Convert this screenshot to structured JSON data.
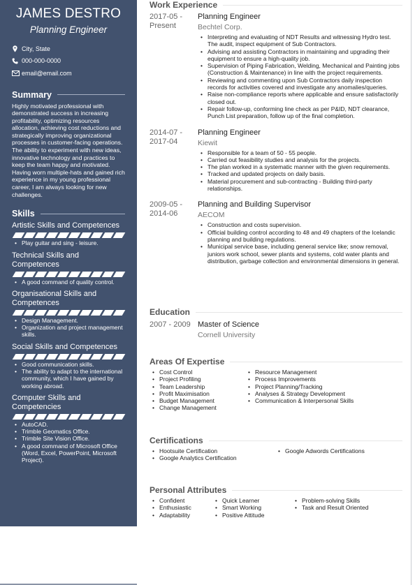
{
  "header": {
    "name": "JAMES DESTRO",
    "role": "Planning Engineer"
  },
  "contacts": [
    {
      "icon": "location-pin-icon",
      "text": "City, State"
    },
    {
      "icon": "phone-icon",
      "text": "000-000-0000"
    },
    {
      "icon": "envelope-icon",
      "text": "email@email.com"
    }
  ],
  "summary": {
    "heading": "Summary",
    "text": "Highly motivated professional with demonstrated success in increasing profitability, optimizing resources allocation, achieving cost reductions and strategically improving organizational processes in customer-facing operations. The ability to experiment with new ideas, innovative technology and practices to keep the team happy and motivated. Having worn multiple-hats and gained rich experience in my young professional career, I am always looking for new challenges."
  },
  "skills": {
    "heading": "Skills",
    "groups": [
      {
        "name": "Artistic Skills and Competences",
        "level": 1.0,
        "items": [
          "Play guitar and sing - leisure."
        ]
      },
      {
        "name": "Technical Skills and Competences",
        "level": 1.0,
        "items": [
          "A good command of quality control."
        ]
      },
      {
        "name": "Organisational Skills and Competences",
        "level": 1.0,
        "items": [
          "Design Management.",
          "Organization and project management skills."
        ]
      },
      {
        "name": "Social Skills and Competences",
        "level": 1.0,
        "items": [
          "Good communication skills.",
          "The ability to adapt to the international community, which I have gained by working abroad."
        ]
      },
      {
        "name": "Computer Skills and Competencies",
        "level": 1.0,
        "items": [
          "AutoCAD.",
          "Trimble Geomatics Office.",
          "Trimble Site Vision Office.",
          "A good command of Microsoft Office (Word, Excel, PowerPoint, Microsoft Project)."
        ]
      }
    ]
  },
  "work": {
    "heading": "Work Experience",
    "jobs": [
      {
        "dates": "2017-05 - Present",
        "title": "Planning Engineer",
        "org": "Bechtel Corp.",
        "items": [
          "Interpreting and evaluating of NDT Results and witnessing Hydro test. The audit, inspect equipment of Sub Contractors.",
          "Advising and assisting Contractors in maintaining and upgrading their equipment to ensure a high-quality job.",
          "Supervision of Piping Fabrication, Welding, Mechanical and Painting jobs (Construction & Maintenance) in line with the project requirements.",
          "Reviewing and commenting upon Sub Contractors daily inspection records for activities covered and investigate any anomalies/queries.",
          "Raise non-compliance reports where applicable and ensure satisfactorily closed out.",
          "Repair follow-up, conforming line check as per P&ID, NDT clearance, Punch List preparation, follow up of the final completion."
        ]
      },
      {
        "dates": "2014-07 - 2017-04",
        "title": "Planning Engineer",
        "org": "Kiewit",
        "items": [
          "Responsible for a team of 50 - 55 people.",
          "Carried out feasibility studies and analysis for the projects.",
          "The plan worked in a systematic manner with the given requirements.",
          "Tracked and updated projects on daily basis.",
          "Material procurement and sub-contracting - Building third-party relationships."
        ]
      },
      {
        "dates": "2009-05 - 2014-06",
        "title": "Planning and Building Supervisor",
        "org": "AECOM",
        "items": [
          "Construction and costs supervision.",
          "Official building control according to 48 and 49 chapters of the Icelandic planning and building regulations.",
          "Municipal service base, including general service like; snow removal, juniors work school, sewer plants and systems, cold water plants and distribution, garbage  collection and environmental dimensions in general."
        ]
      }
    ]
  },
  "education": {
    "heading": "Education",
    "entries": [
      {
        "dates": "2007 - 2009",
        "degree": "Master of Science",
        "school": "Cornell University"
      }
    ]
  },
  "expertise": {
    "heading": "Areas Of Expertise",
    "columns": [
      [
        "Cost Control",
        "Project Profiling",
        "Team Leadership",
        "Profit Maximisation",
        "Budget Management",
        "Change Management"
      ],
      [
        "Resource Management",
        "Process Improvements",
        "Project Planning/Tracking",
        "Analyses & Strategy Development",
        "Communication & Interpersonal Skills"
      ]
    ]
  },
  "certifications": {
    "heading": "Certifications",
    "columns": [
      [
        "Hootsuite Certification",
        "Google Analytics Certification"
      ],
      [
        "Google Adwords Certifications"
      ]
    ]
  },
  "attributes": {
    "heading": "Personal Attributes",
    "columns": [
      [
        "Confident",
        "Enthusiastic",
        "Adaptability"
      ],
      [
        "Quick Learner",
        "Smart Working",
        "Positive Attitude"
      ],
      [
        "Problem-solving Skills",
        "Task and Result Oriented"
      ]
    ]
  }
}
